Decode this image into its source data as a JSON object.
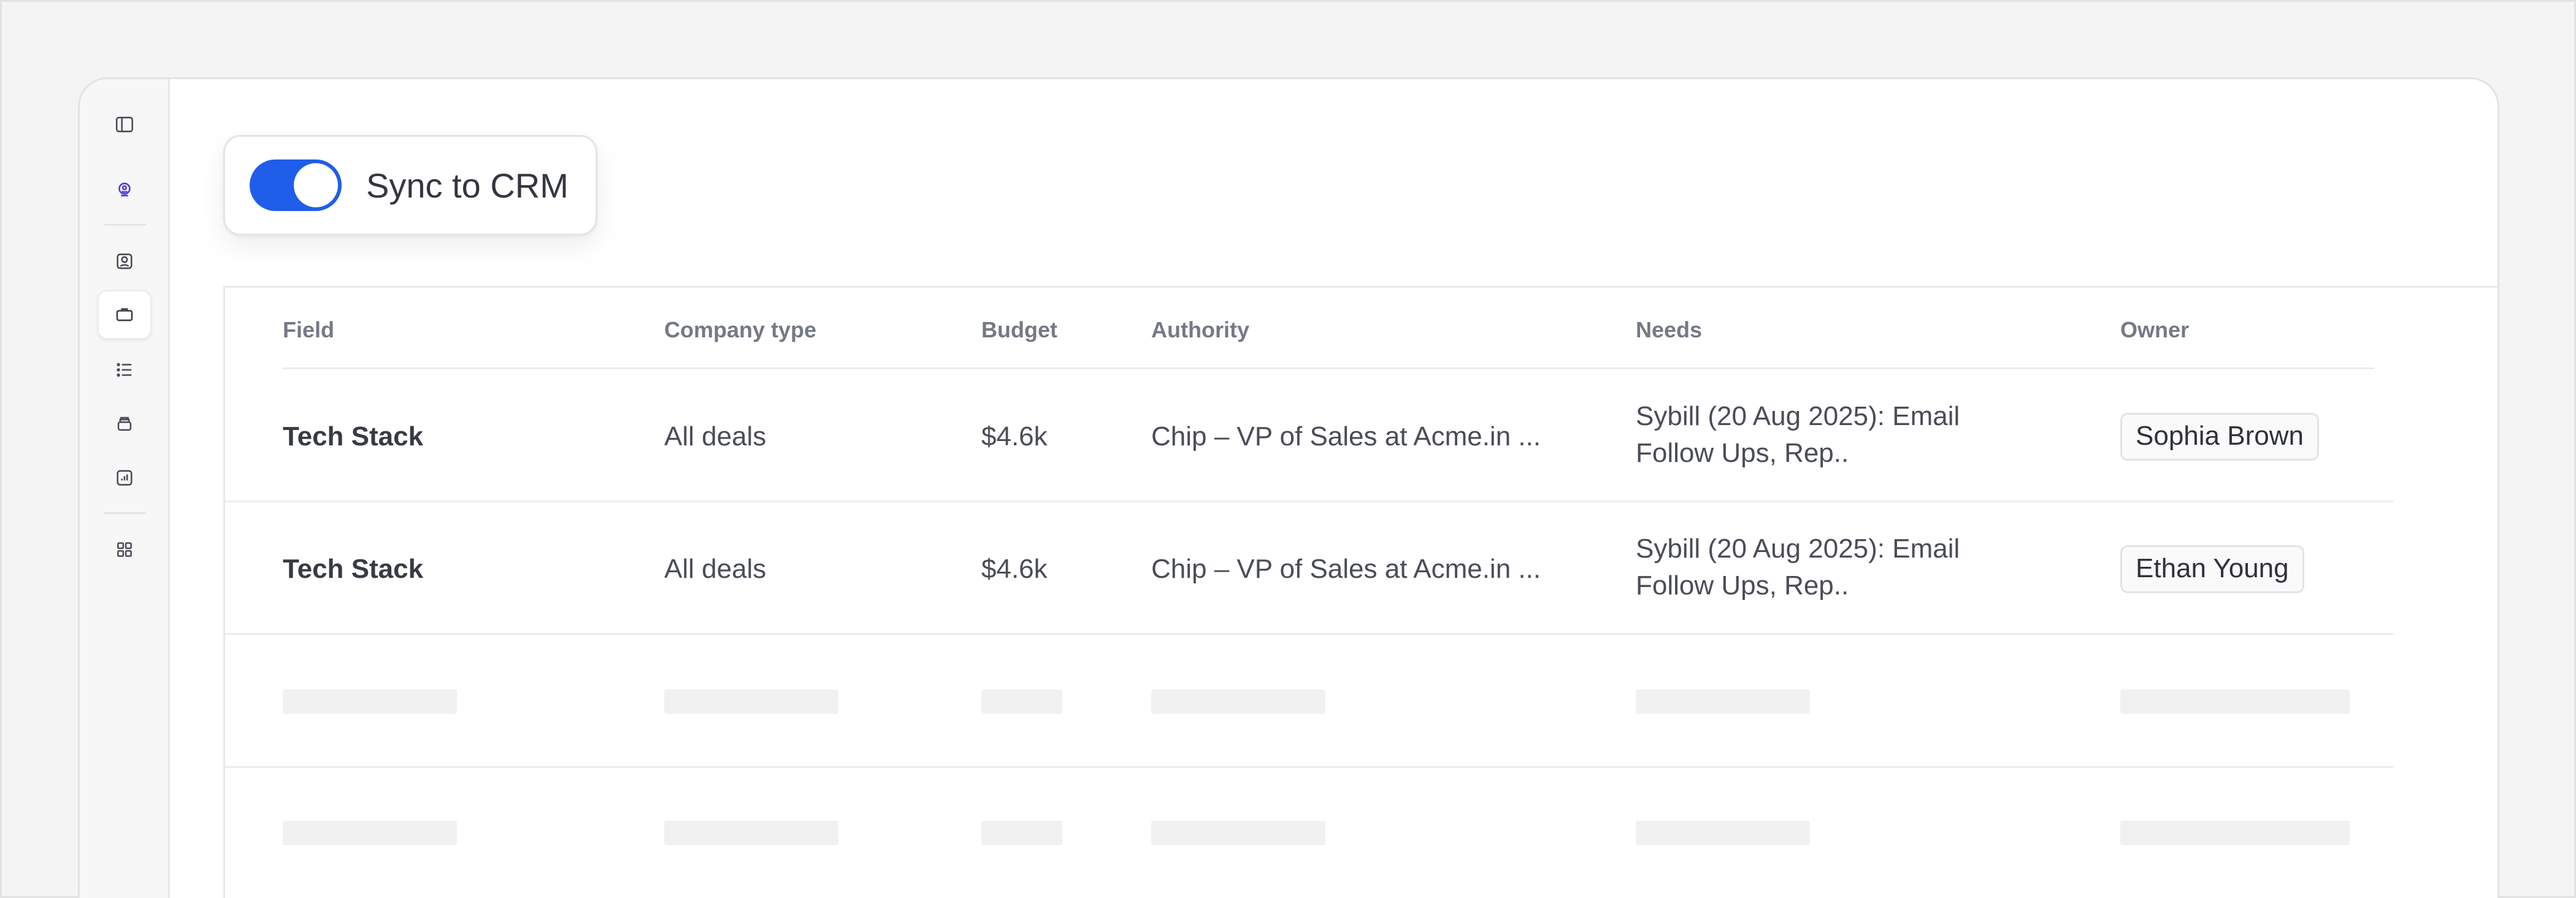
{
  "sidebar": {
    "icons": [
      "sidebar-toggle-icon",
      "robot-icon",
      "contact-icon",
      "briefcase-icon",
      "list-icon",
      "inbox-icon",
      "chart-icon",
      "grid-icon"
    ],
    "accent": "#4b3fd6"
  },
  "sync": {
    "label": "Sync to CRM",
    "enabled": true,
    "toggle_color": "#1f5eea"
  },
  "table": {
    "columns": [
      "Field",
      "Company type",
      "Budget",
      "Authority",
      "Needs",
      "Owner"
    ],
    "rows": [
      {
        "field": "Tech Stack",
        "company_type": "All deals",
        "budget": "$4.6k",
        "authority": "Chip – VP of Sales at Acme.in ...",
        "needs": "Sybill (20 Aug 2025): Email Follow Ups, Rep..",
        "owner": "Sophia Brown"
      },
      {
        "field": "Tech Stack",
        "company_type": "All deals",
        "budget": "$4.6k",
        "authority": "Chip – VP of Sales at Acme.in ...",
        "needs": "Sybill (20 Aug 2025): Email Follow Ups, Rep..",
        "owner": "Ethan Young"
      }
    ]
  }
}
